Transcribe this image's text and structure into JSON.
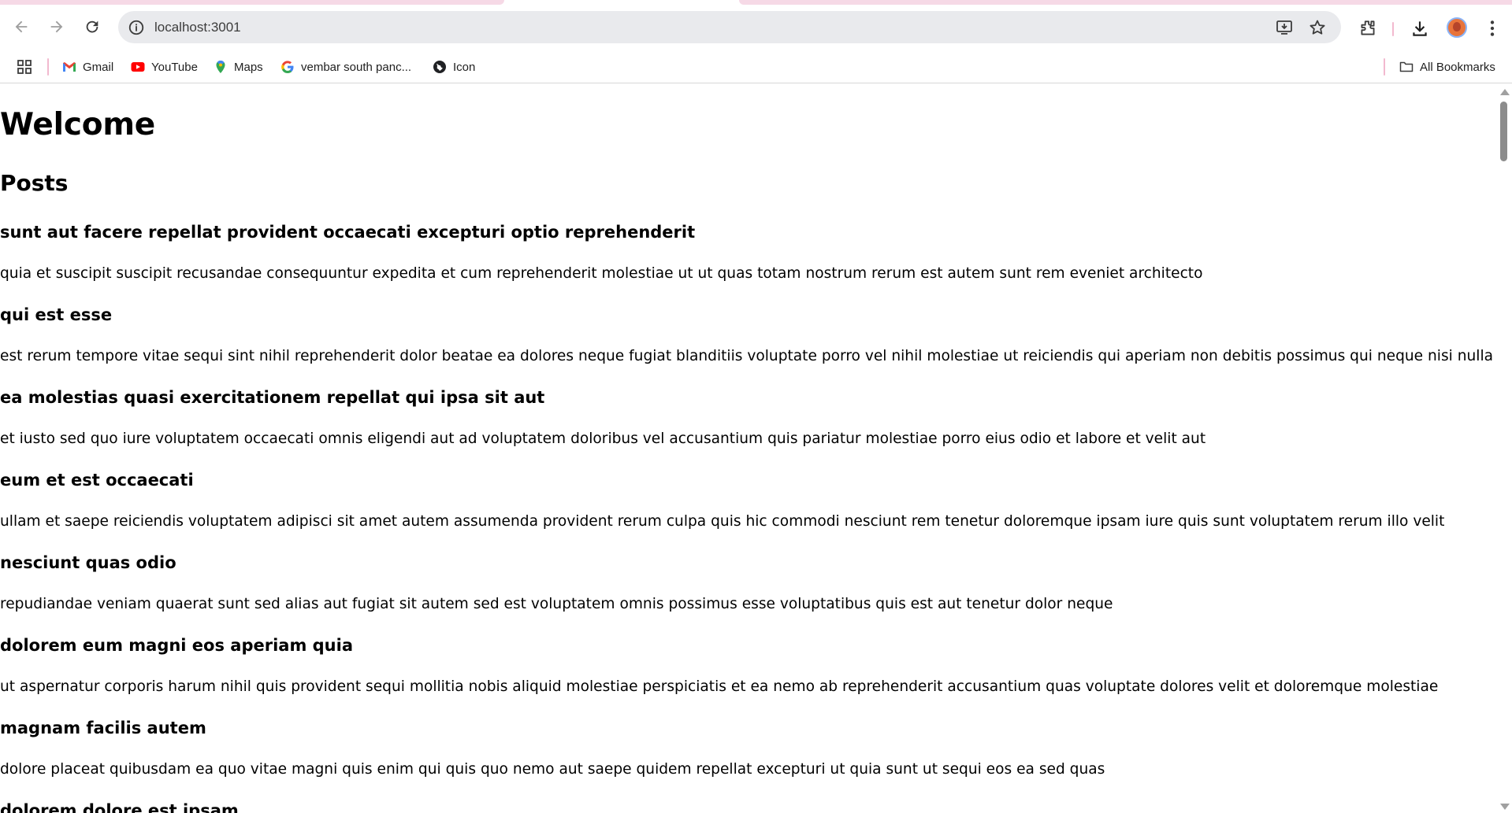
{
  "browser": {
    "url": "localhost:3001",
    "bookmarks": [
      {
        "label": "Gmail",
        "icon": "gmail-icon"
      },
      {
        "label": "YouTube",
        "icon": "youtube-icon"
      },
      {
        "label": "Maps",
        "icon": "maps-icon"
      },
      {
        "label": "vembar south panc...",
        "icon": "google-icon"
      },
      {
        "label": "Icon",
        "icon": "globe-icon"
      }
    ],
    "all_bookmarks_label": "All Bookmarks",
    "colors": {
      "tab_accent": "#f6d9e6",
      "omnibox_bg": "#e9eaed"
    }
  },
  "page": {
    "heading": "Welcome",
    "subheading": "Posts",
    "posts": [
      {
        "title": "sunt aut facere repellat provident occaecati excepturi optio reprehenderit",
        "body": "quia et suscipit suscipit recusandae consequuntur expedita et cum reprehenderit molestiae ut ut quas totam nostrum rerum est autem sunt rem eveniet architecto"
      },
      {
        "title": "qui est esse",
        "body": "est rerum tempore vitae sequi sint nihil reprehenderit dolor beatae ea dolores neque fugiat blanditiis voluptate porro vel nihil molestiae ut reiciendis qui aperiam non debitis possimus qui neque nisi nulla"
      },
      {
        "title": "ea molestias quasi exercitationem repellat qui ipsa sit aut",
        "body": "et iusto sed quo iure voluptatem occaecati omnis eligendi aut ad voluptatem doloribus vel accusantium quis pariatur molestiae porro eius odio et labore et velit aut"
      },
      {
        "title": "eum et est occaecati",
        "body": "ullam et saepe reiciendis voluptatem adipisci sit amet autem assumenda provident rerum culpa quis hic commodi nesciunt rem tenetur doloremque ipsam iure quis sunt voluptatem rerum illo velit"
      },
      {
        "title": "nesciunt quas odio",
        "body": "repudiandae veniam quaerat sunt sed alias aut fugiat sit autem sed est voluptatem omnis possimus esse voluptatibus quis est aut tenetur dolor neque"
      },
      {
        "title": "dolorem eum magni eos aperiam quia",
        "body": "ut aspernatur corporis harum nihil quis provident sequi mollitia nobis aliquid molestiae perspiciatis et ea nemo ab reprehenderit accusantium quas voluptate dolores velit et doloremque molestiae"
      },
      {
        "title": "magnam facilis autem",
        "body": "dolore placeat quibusdam ea quo vitae magni quis enim qui quis quo nemo aut saepe quidem repellat excepturi ut quia sunt ut sequi eos ea sed quas"
      },
      {
        "title": "dolorem dolore est ipsam",
        "body": ""
      }
    ]
  }
}
